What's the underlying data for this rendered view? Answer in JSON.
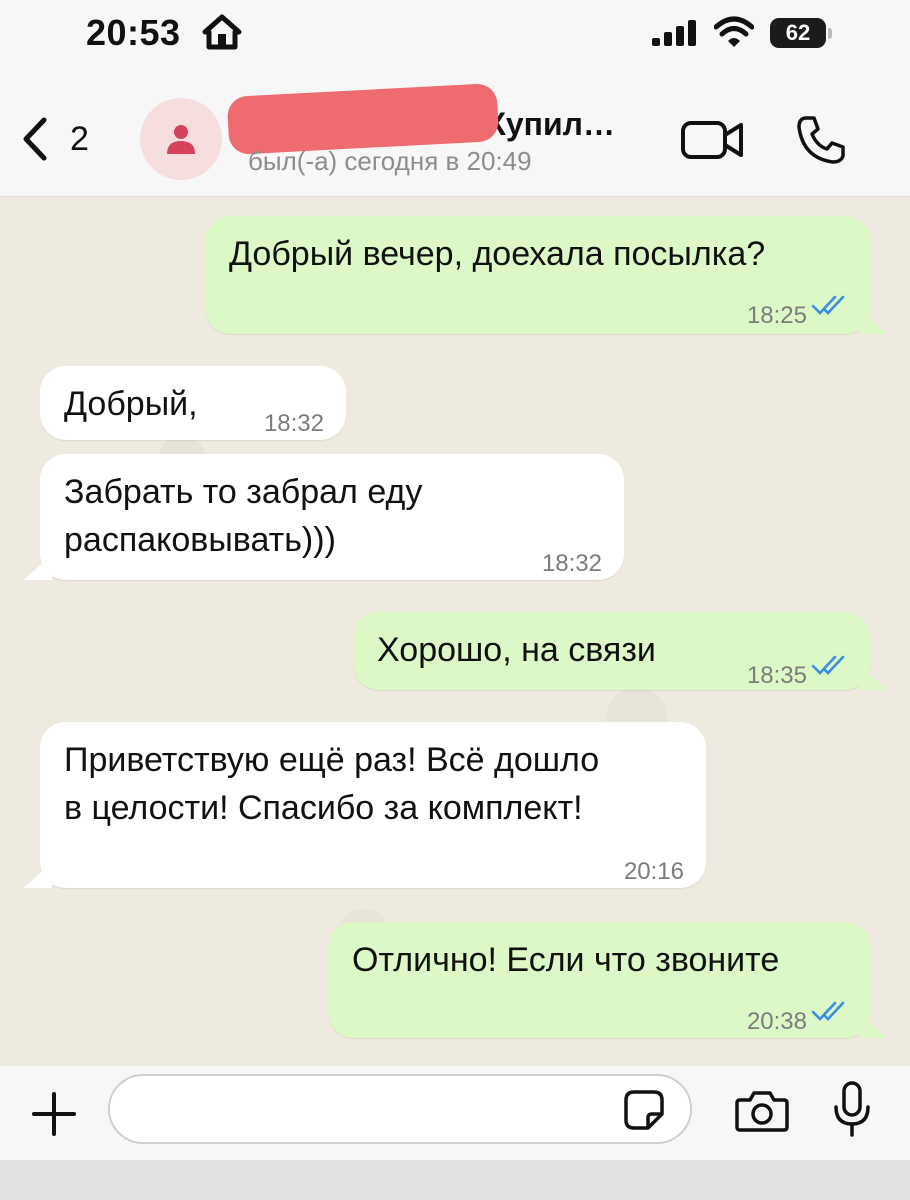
{
  "status_bar": {
    "time": "20:53",
    "battery": "62"
  },
  "header": {
    "back_count": "2",
    "contact_name": "Купил…",
    "last_seen": "был(-а) сегодня в 20:49"
  },
  "messages": [
    {
      "direction": "out",
      "text": "Добрый вечер, доехала посылка?",
      "time": "18:25",
      "status": "read"
    },
    {
      "direction": "in",
      "text": "Добрый,",
      "time": "18:32"
    },
    {
      "direction": "in",
      "text": "Забрать то забрал  еду\nраспаковывать)))",
      "time": "18:32"
    },
    {
      "direction": "out",
      "text": "Хорошо, на связи",
      "time": "18:35",
      "status": "read"
    },
    {
      "direction": "in",
      "text": "Приветствую ещё раз! Всё дошло\nв целости! Спасибо за комплект!",
      "time": "20:16"
    },
    {
      "direction": "out",
      "text": "Отлично! Если что звоните",
      "time": "20:38",
      "status": "read"
    }
  ],
  "composer": {
    "value": ""
  },
  "colors": {
    "outgoing_bubble": "#dcf8c6",
    "incoming_bubble": "#ffffff",
    "read_ticks": "#3b8de6",
    "avatar_bg": "#f7dede",
    "avatar_icon": "#d6425a"
  }
}
